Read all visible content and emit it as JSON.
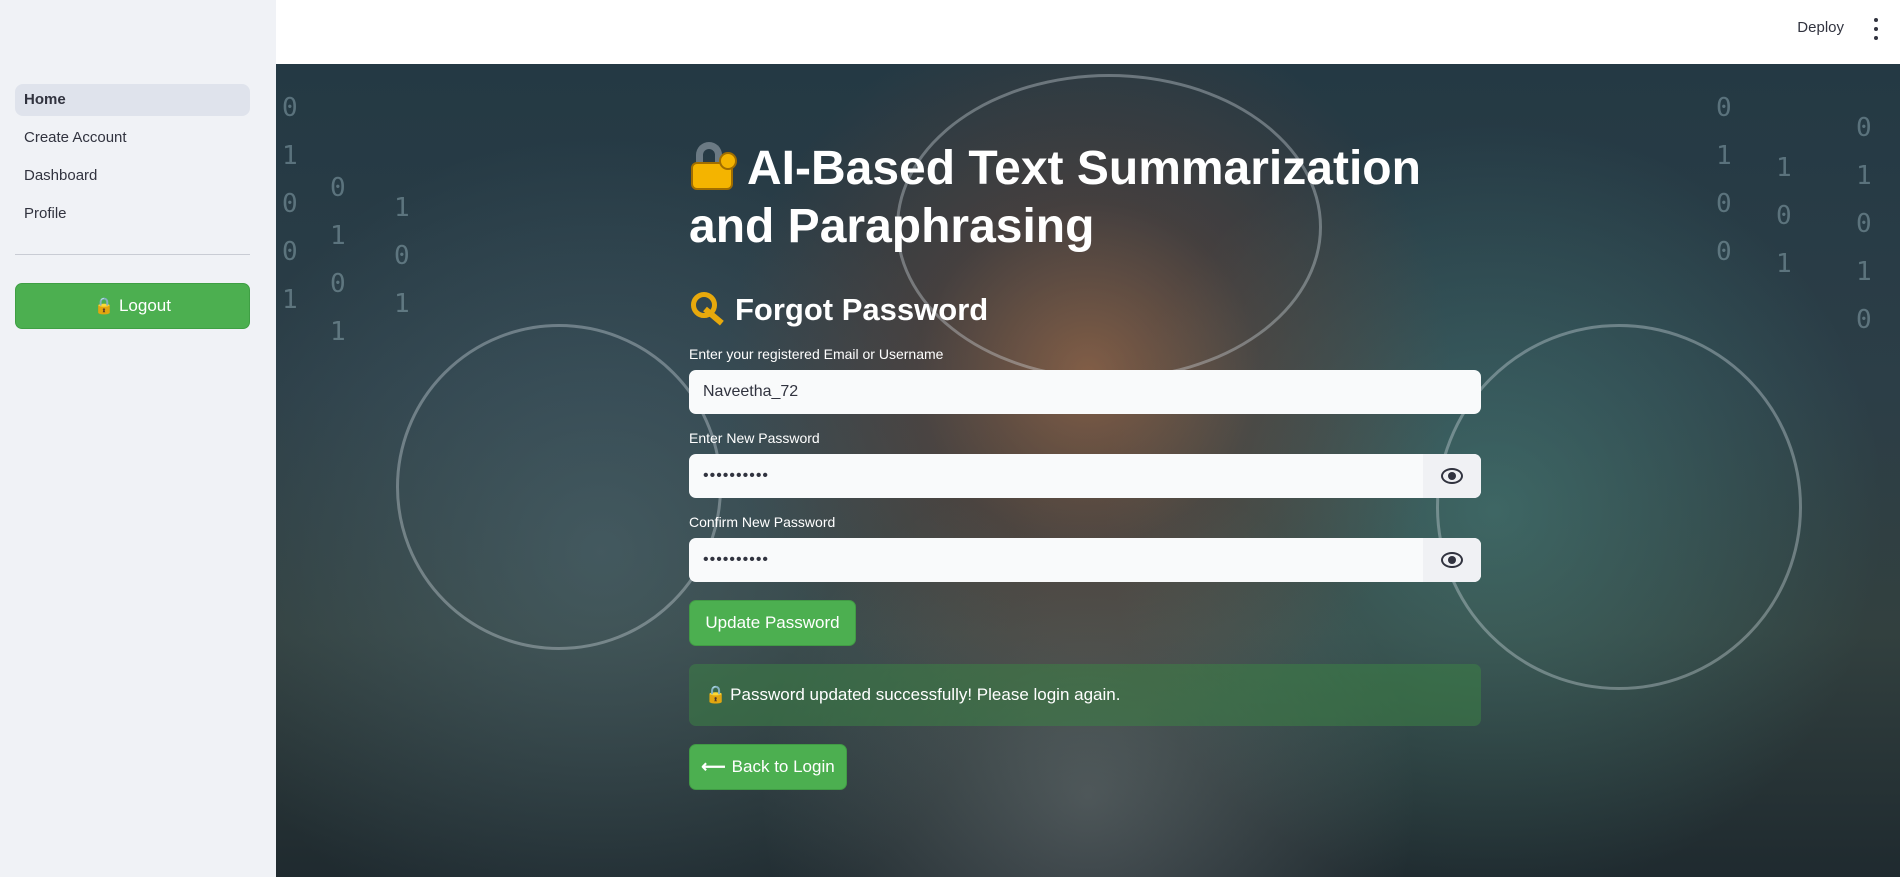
{
  "sidebar": {
    "items": [
      {
        "label": "Home",
        "active": true
      },
      {
        "label": "Create Account"
      },
      {
        "label": "Dashboard"
      },
      {
        "label": "Profile"
      }
    ],
    "logout_label": "Logout",
    "logout_icon": "lock-icon"
  },
  "header": {
    "deploy_label": "Deploy",
    "menu_icon": "kebab-menu-icon"
  },
  "main": {
    "title": "AI-Based Text Summarization and Paraphrasing",
    "title_icon": "locked-with-key-emoji",
    "subtitle": "Forgot Password",
    "subtitle_icon": "key-emoji",
    "form": {
      "username_label": "Enter your registered Email or Username",
      "username_value": "Naveetha_72",
      "new_password_label": "Enter New Password",
      "new_password_value": "••••••••••",
      "confirm_password_label": "Confirm New Password",
      "confirm_password_value": "••••••••••",
      "update_button": "Update Password"
    },
    "success_message": "Password updated successfully! Please login again.",
    "back_button": "Back to Login"
  },
  "colors": {
    "accent_green": "#4caf50",
    "sidebar_bg": "#f0f2f6",
    "text_dark": "#31333f"
  }
}
